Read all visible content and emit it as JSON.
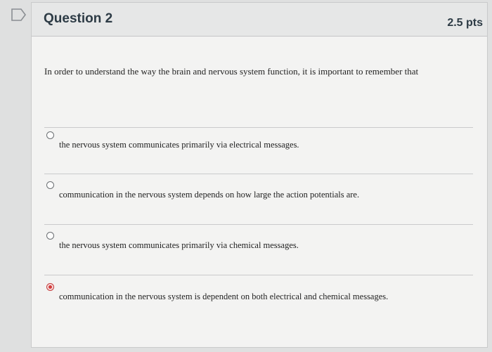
{
  "question": {
    "title": "Question 2",
    "points": "2.5 pts",
    "prompt": "In order to understand the way the brain and nervous system function, it is important to remember that"
  },
  "answers": [
    {
      "label": "the nervous system communicates primarily via electrical messages.",
      "selected": false
    },
    {
      "label": "communication in the nervous system depends on how large the action potentials are.",
      "selected": false
    },
    {
      "label": "the nervous system communicates primarily via chemical messages.",
      "selected": false
    },
    {
      "label": "communication in the nervous system is dependent on both electrical and chemical messages.",
      "selected": true
    }
  ],
  "colors": {
    "selected_radio": "#d33a3a",
    "heading_text": "#2d3b45"
  }
}
